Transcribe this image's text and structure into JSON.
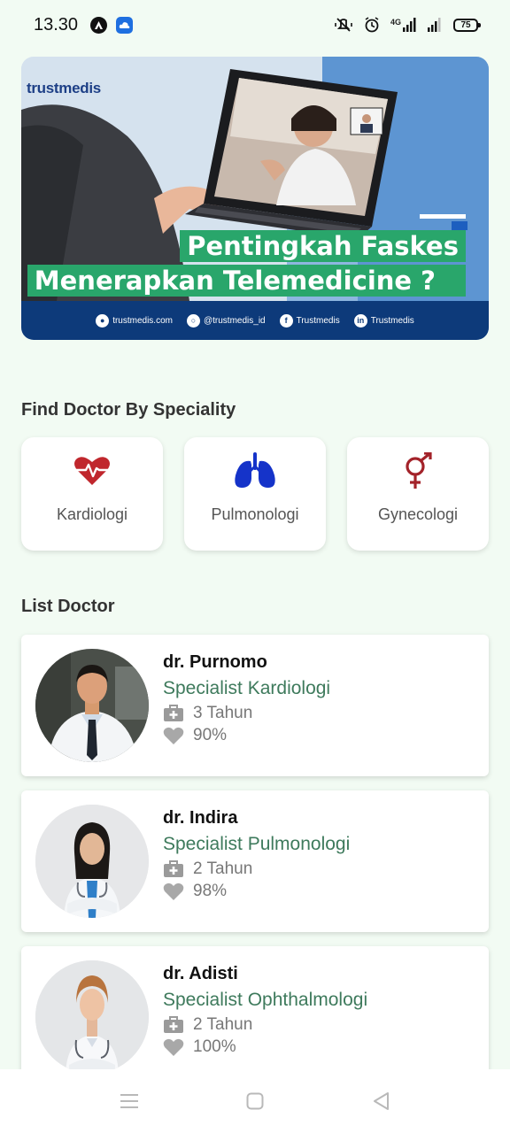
{
  "status_bar": {
    "time": "13.30",
    "battery": "75",
    "network": "4G"
  },
  "banner": {
    "logo": "trustmedis",
    "title_line1": "Pentingkah Faskes",
    "title_line2": "Menerapkan Telemedicine ?",
    "footer": [
      {
        "icon": "globe-icon",
        "text": "trustmedis.com"
      },
      {
        "icon": "instagram-icon",
        "text": "@trustmedis_id"
      },
      {
        "icon": "facebook-icon",
        "text": "Trustmedis"
      },
      {
        "icon": "linkedin-icon",
        "text": "Trustmedis"
      }
    ]
  },
  "speciality": {
    "title": "Find Doctor By Speciality",
    "items": [
      {
        "label": "Kardiologi",
        "icon": "heart-pulse-icon",
        "color": "#c0272d"
      },
      {
        "label": "Pulmonologi",
        "icon": "lungs-icon",
        "color": "#1533c9"
      },
      {
        "label": "Gynecologi",
        "icon": "gender-icon",
        "color": "#a3232a"
      }
    ]
  },
  "doctors": {
    "title": "List Doctor",
    "items": [
      {
        "name": "dr. Purnomo",
        "speciality": "Specialist Kardiologi",
        "experience": "3 Tahun",
        "rating": "90%"
      },
      {
        "name": "dr. Indira",
        "speciality": "Specialist Pulmonologi",
        "experience": "2 Tahun",
        "rating": "98%"
      },
      {
        "name": "dr. Adisti",
        "speciality": "Specialist Ophthalmologi",
        "experience": "2 Tahun",
        "rating": "100%"
      }
    ]
  },
  "colors": {
    "background": "#f2fbf3",
    "accent_green": "#29a66b",
    "speciality_text": "#3e7a5c",
    "banner_footer": "#0d3a7a"
  }
}
